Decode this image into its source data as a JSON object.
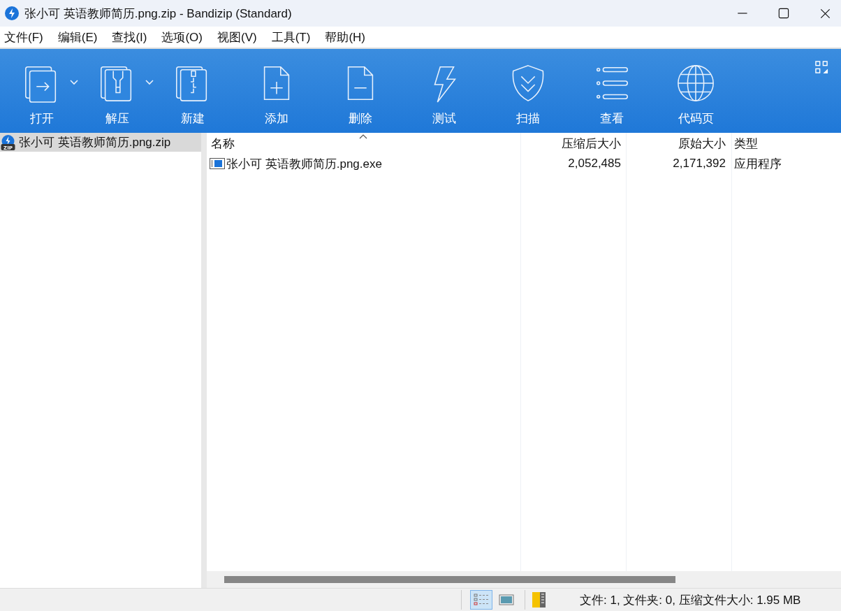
{
  "window": {
    "title": "张小可 英语教师简历.png.zip - Bandizip (Standard)"
  },
  "menu": [
    "文件(F)",
    "编辑(E)",
    "查找(I)",
    "选项(O)",
    "视图(V)",
    "工具(T)",
    "帮助(H)"
  ],
  "toolbar": [
    {
      "label": "打开",
      "dropdown": true
    },
    {
      "label": "解压",
      "dropdown": true
    },
    {
      "label": "新建",
      "dropdown": false
    },
    {
      "label": "添加",
      "dropdown": false
    },
    {
      "label": "删除",
      "dropdown": false
    },
    {
      "label": "测试",
      "dropdown": false
    },
    {
      "label": "扫描",
      "dropdown": false
    },
    {
      "label": "查看",
      "dropdown": false
    },
    {
      "label": "代码页",
      "dropdown": false
    }
  ],
  "sidebar": {
    "items": [
      {
        "label": "张小可 英语教师简历.png.zip",
        "icon_text": "ZIP",
        "selected": true
      }
    ]
  },
  "table": {
    "columns": [
      {
        "label": "名称",
        "sorted": true
      },
      {
        "label": "压缩后大小",
        "sorted": false
      },
      {
        "label": "原始大小",
        "sorted": false
      },
      {
        "label": "类型",
        "sorted": false
      }
    ],
    "rows": [
      {
        "cells": [
          "张小可 英语教师简历.png.exe",
          "2,052,485",
          "2,171,392",
          "应用程序"
        ],
        "selected": false
      }
    ]
  },
  "status_bar": {
    "views": [
      {
        "kind": "details",
        "selected": true
      },
      {
        "kind": "thumbnails",
        "selected": false
      }
    ],
    "text": "文件: 1, 文件夹: 0, 压缩文件大小: 1.95 MB"
  }
}
